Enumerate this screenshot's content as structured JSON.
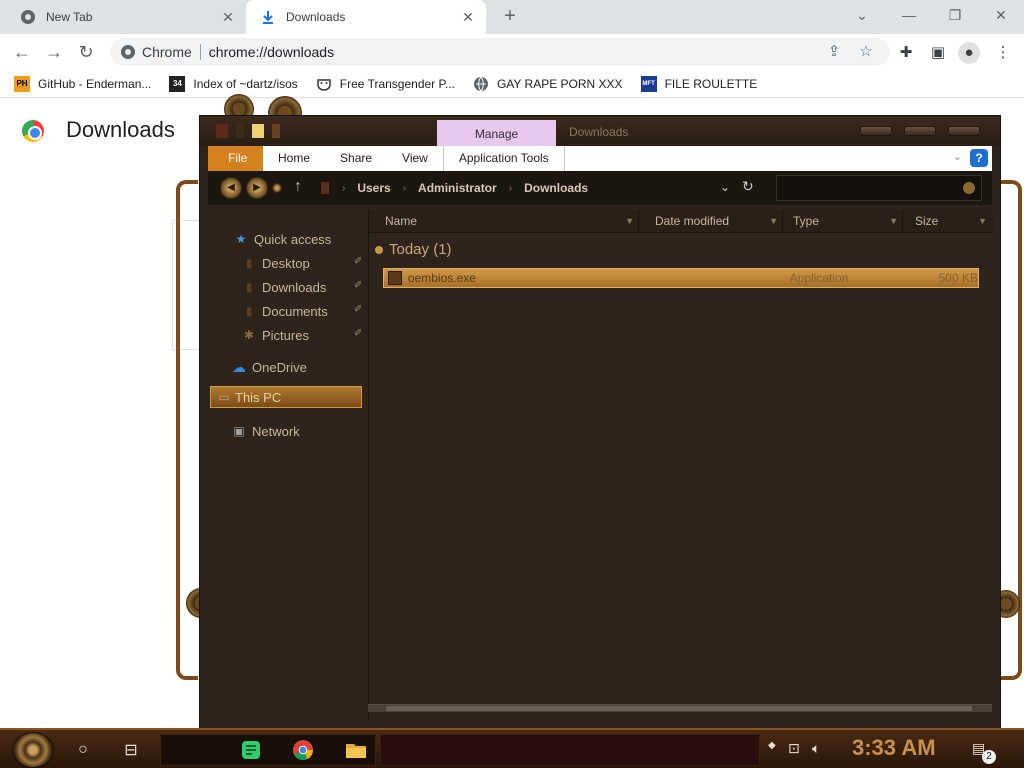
{
  "chrome": {
    "tabs": [
      {
        "title": "New Tab",
        "icon": "chrome-icon"
      },
      {
        "title": "Downloads",
        "icon": "download-icon",
        "active": true
      }
    ],
    "site_chip": "Chrome",
    "url": "chrome://downloads",
    "bookmarks": [
      {
        "label": "GitHub - Enderman...",
        "icon": "ph-icon",
        "icon_text": "PH"
      },
      {
        "label": "Index of ~dartz/isos",
        "icon": "34-icon",
        "icon_text": "34"
      },
      {
        "label": "Free Transgender P...",
        "icon": "mask-icon"
      },
      {
        "label": "GAY RAPE PORN XXX",
        "icon": "globe-icon"
      },
      {
        "label": "FILE ROULETTE",
        "icon": "mft-icon",
        "icon_text": "MFT"
      }
    ],
    "page_title": "Downloads"
  },
  "explorer": {
    "window_title": "Downloads",
    "context_tab": "Manage",
    "ribbon": {
      "file": "File",
      "tabs": [
        "Home",
        "Share",
        "View"
      ],
      "app_tools": "Application Tools"
    },
    "breadcrumb": [
      "Users",
      "Administrator",
      "Downloads"
    ],
    "nav": {
      "quick_access": "Quick access",
      "pinned": [
        "Desktop",
        "Downloads",
        "Documents",
        "Pictures"
      ],
      "onedrive": "OneDrive",
      "this_pc": "This PC",
      "network": "Network"
    },
    "columns": [
      "Name",
      "Date modified",
      "Type",
      "Size"
    ],
    "group": "Today (1)",
    "files": [
      {
        "name": "oembios.exe",
        "date": "",
        "type": "Application",
        "size": "500 KB"
      }
    ]
  },
  "taskbar": {
    "clock": "3:33 AM",
    "notification_count": "2"
  },
  "colors": {
    "ribbon_file": "#d4821e",
    "manage_tab": "#e6c8f0",
    "selection": "#b07a30",
    "clock": "#c89048"
  }
}
